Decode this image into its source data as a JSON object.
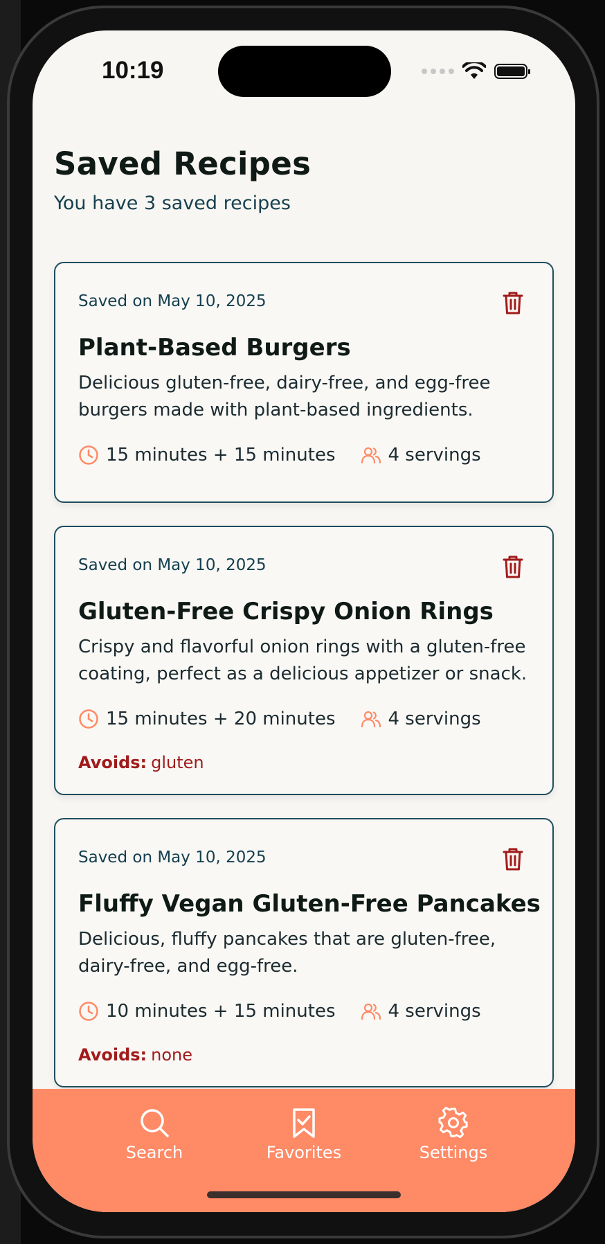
{
  "status_bar": {
    "time": "10:19"
  },
  "header": {
    "title": "Saved Recipes",
    "subtitle": "You have 3 saved recipes"
  },
  "recipes": [
    {
      "saved_on": "Saved on May 10, 2025",
      "title": "Plant-Based Burgers",
      "description": "Delicious gluten-free, dairy-free, and egg-free burgers made with plant-based ingredients.",
      "time": "15 minutes + 15 minutes",
      "servings": "4 servings",
      "avoids_label": "",
      "avoids_value": ""
    },
    {
      "saved_on": "Saved on May 10, 2025",
      "title": "Gluten-Free Crispy Onion Rings",
      "description": "Crispy and flavorful onion rings with a gluten-free coating, perfect as a delicious appetizer or snack.",
      "time": "15 minutes + 20 minutes",
      "servings": "4 servings",
      "avoids_label": "Avoids:",
      "avoids_value": "gluten"
    },
    {
      "saved_on": "Saved on May 10, 2025",
      "title": "Fluffy Vegan Gluten-Free Pancakes",
      "description": "Delicious, fluffy pancakes that are gluten-free, dairy-free, and egg-free.",
      "time": "10 minutes + 15 minutes",
      "servings": "4 servings",
      "avoids_label": "Avoids:",
      "avoids_value": "none"
    }
  ],
  "tab_bar": {
    "items": [
      {
        "label": "Search",
        "icon": "search-icon"
      },
      {
        "label": "Favorites",
        "icon": "bookmark-check-icon"
      },
      {
        "label": "Settings",
        "icon": "gear-icon"
      }
    ],
    "background": "#ff8a66"
  },
  "colors": {
    "accent": "#ff8a66",
    "card_border": "#1f4d5e",
    "danger": "#a11b1b",
    "background": "#f8f6f2"
  }
}
